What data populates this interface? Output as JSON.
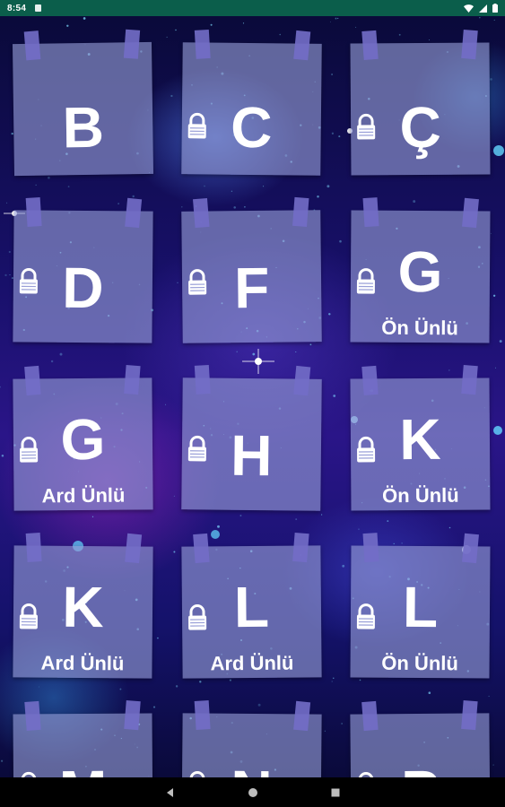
{
  "status_bar": {
    "time": "8:54",
    "icons": [
      "notification-icon",
      "wifi-icon",
      "signal-icon",
      "battery-icon"
    ]
  },
  "letters": [
    {
      "letter": "B",
      "sublabel": "",
      "locked": false
    },
    {
      "letter": "C",
      "sublabel": "",
      "locked": true
    },
    {
      "letter": "Ç",
      "sublabel": "",
      "locked": true
    },
    {
      "letter": "D",
      "sublabel": "",
      "locked": true
    },
    {
      "letter": "F",
      "sublabel": "",
      "locked": true
    },
    {
      "letter": "G",
      "sublabel": "Ön Ünlü",
      "locked": true
    },
    {
      "letter": "G",
      "sublabel": "Ard Ünlü",
      "locked": true
    },
    {
      "letter": "H",
      "sublabel": "",
      "locked": true
    },
    {
      "letter": "K",
      "sublabel": "Ön Ünlü",
      "locked": true
    },
    {
      "letter": "K",
      "sublabel": "Ard Ünlü",
      "locked": true
    },
    {
      "letter": "L",
      "sublabel": "Ard Ünlü",
      "locked": true
    },
    {
      "letter": "L",
      "sublabel": "Ön Ünlü",
      "locked": true
    },
    {
      "letter": "M",
      "sublabel": "",
      "locked": true
    },
    {
      "letter": "N",
      "sublabel": "",
      "locked": true
    },
    {
      "letter": "P",
      "sublabel": "",
      "locked": true
    }
  ],
  "nav_bar": {
    "icons": [
      "back-icon",
      "home-icon",
      "recents-icon"
    ]
  }
}
